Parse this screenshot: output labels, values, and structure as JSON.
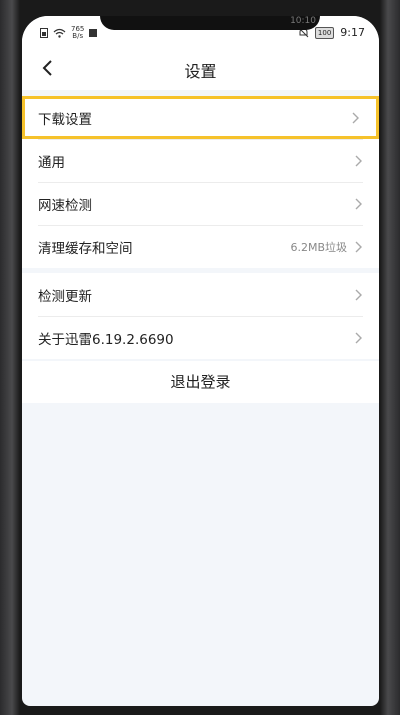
{
  "status_bar": {
    "net_speed_top": "765",
    "net_speed_bottom": "B/s",
    "battery": "100",
    "time": "9:17",
    "notch_time": "10:10"
  },
  "header": {
    "title": "设置"
  },
  "group1": [
    {
      "label": "下载设置",
      "value": ""
    },
    {
      "label": "通用",
      "value": ""
    },
    {
      "label": "网速检测",
      "value": ""
    },
    {
      "label": "清理缓存和空间",
      "value": "6.2MB垃圾"
    }
  ],
  "group2": [
    {
      "label": "检测更新",
      "value": ""
    },
    {
      "label": "关于迅雷6.19.2.6690",
      "value": ""
    }
  ],
  "logout_label": "退出登录",
  "colors": {
    "highlight": "#f6c22b",
    "background": "#f3f6fa"
  }
}
